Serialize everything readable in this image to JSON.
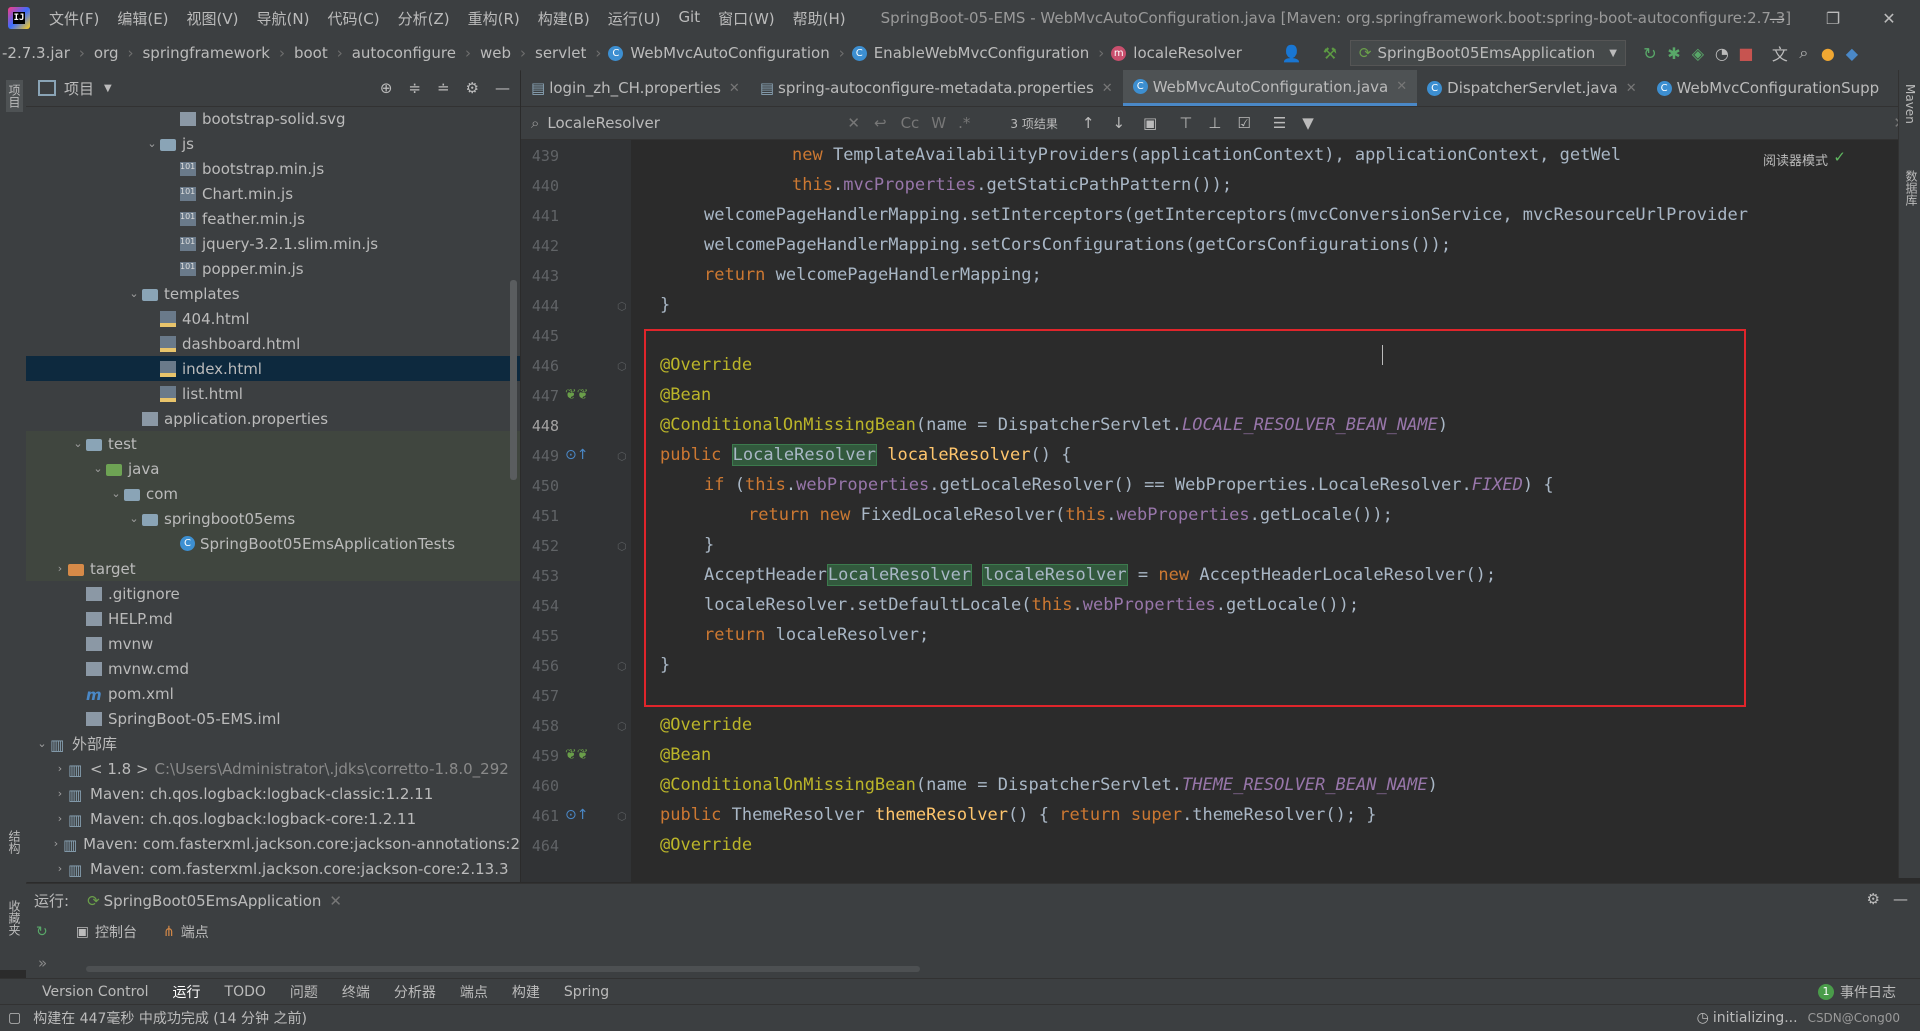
{
  "menu": [
    "文件(F)",
    "编辑(E)",
    "视图(V)",
    "导航(N)",
    "代码(C)",
    "分析(Z)",
    "重构(R)",
    "构建(B)",
    "运行(U)",
    "Git",
    "窗口(W)",
    "帮助(H)"
  ],
  "window_title": "SpringBoot-05-EMS - WebMvcAutoConfiguration.java [Maven: org.springframework.boot:spring-boot-autoconfigure:2.7.3]",
  "breadcrumbs": [
    "-2.7.3.jar",
    "org",
    "springframework",
    "boot",
    "autoconfigure",
    "web",
    "servlet",
    "WebMvcAutoConfiguration",
    "EnableWebMvcConfiguration",
    "localeResolver"
  ],
  "run_config": "SpringBoot05EmsApplication",
  "project_panel": {
    "title": "项目"
  },
  "tree": [
    {
      "label": "bootstrap-solid.svg",
      "icon": "file"
    },
    {
      "label": "js",
      "icon": "folder"
    },
    {
      "label": "bootstrap.min.js",
      "icon": "js"
    },
    {
      "label": "Chart.min.js",
      "icon": "js"
    },
    {
      "label": "feather.min.js",
      "icon": "js"
    },
    {
      "label": "jquery-3.2.1.slim.min.js",
      "icon": "js"
    },
    {
      "label": "popper.min.js",
      "icon": "js"
    },
    {
      "label": "templates",
      "icon": "folder"
    },
    {
      "label": "404.html",
      "icon": "html"
    },
    {
      "label": "dashboard.html",
      "icon": "html"
    },
    {
      "label": "index.html",
      "icon": "html"
    },
    {
      "label": "list.html",
      "icon": "html"
    },
    {
      "label": "application.properties",
      "icon": "file"
    },
    {
      "label": "test",
      "icon": "folder"
    },
    {
      "label": "java",
      "icon": "folder-green"
    },
    {
      "label": "com",
      "icon": "folder"
    },
    {
      "label": "springboot05ems",
      "icon": "folder"
    },
    {
      "label": "SpringBoot05EmsApplicationTests",
      "icon": "class"
    },
    {
      "label": "target",
      "icon": "folder-orange"
    },
    {
      "label": ".gitignore",
      "icon": "file"
    },
    {
      "label": "HELP.md",
      "icon": "file"
    },
    {
      "label": "mvnw",
      "icon": "file"
    },
    {
      "label": "mvnw.cmd",
      "icon": "file"
    },
    {
      "label": "pom.xml",
      "icon": "maven"
    },
    {
      "label": "SpringBoot-05-EMS.iml",
      "icon": "file"
    },
    {
      "label": "外部库",
      "icon": "lib"
    },
    {
      "label": "< 1.8 >",
      "icon": "lib",
      "extra": "C:\\Users\\Administrator\\.jdks\\corretto-1.8.0_292"
    },
    {
      "label": "Maven: ch.qos.logback:logback-classic:1.2.11",
      "icon": "lib"
    },
    {
      "label": "Maven: ch.qos.logback:logback-core:1.2.11",
      "icon": "lib"
    },
    {
      "label": "Maven: com.fasterxml.jackson.core:jackson-annotations:2",
      "icon": "lib"
    },
    {
      "label": "Maven: com.fasterxml.jackson.core:jackson-core:2.13.3",
      "icon": "lib"
    }
  ],
  "tabs": [
    "login_zh_CH.properties",
    "spring-autoconfigure-metadata.properties",
    "WebMvcAutoConfiguration.java",
    "DispatcherServlet.java",
    "WebMvcConfigurationSupp"
  ],
  "search": {
    "query": "LocaleResolver",
    "results": "3 项结果",
    "options": [
      "Cc",
      "W",
      ".*"
    ]
  },
  "reader_mode": "阅读器模式",
  "line_numbers": [
    "439",
    "440",
    "441",
    "442",
    "443",
    "444",
    "445",
    "446",
    "447",
    "448",
    "449",
    "450",
    "451",
    "452",
    "453",
    "454",
    "455",
    "456",
    "457",
    "458",
    "459",
    "460",
    "461",
    "464"
  ],
  "code_lines": [
    "new TemplateAvailabilityProviders(applicationContext), applicationContext, getWel",
    "this.mvcProperties.getStaticPathPattern());",
    "welcomePageHandlerMapping.setInterceptors(getInterceptors(mvcConversionService, mvcResourceUrlProvider",
    "welcomePageHandlerMapping.setCorsConfigurations(getCorsConfigurations());",
    "return welcomePageHandlerMapping;",
    "}",
    "",
    "@Override",
    "@Bean",
    "@ConditionalOnMissingBean(name = DispatcherServlet.LOCALE_RESOLVER_BEAN_NAME)",
    "public LocaleResolver localeResolver() {",
    "if (this.webProperties.getLocaleResolver() == WebProperties.LocaleResolver.FIXED) {",
    "return new FixedLocaleResolver(this.webProperties.getLocale());",
    "}",
    "AcceptHeaderLocaleResolver localeResolver = new AcceptHeaderLocaleResolver();",
    "localeResolver.setDefaultLocale(this.webProperties.getLocale());",
    "return localeResolver;",
    "}",
    "",
    "@Override",
    "@Bean",
    "@ConditionalOnMissingBean(name = DispatcherServlet.THEME_RESOLVER_BEAN_NAME)",
    "public ThemeResolver themeResolver() { return super.themeResolver(); }",
    "@Override"
  ],
  "run_panel": {
    "label": "运行:",
    "config": "SpringBoot05EmsApplication",
    "tabs": [
      "控制台",
      "端点"
    ]
  },
  "tool_windows": [
    "Version Control",
    "运行",
    "TODO",
    "问题",
    "终端",
    "分析器",
    "端点",
    "构建",
    "Spring"
  ],
  "event_log": {
    "count": "1",
    "label": "事件日志"
  },
  "status": {
    "message": "构建在 447毫秒 中成功完成 (14 分钟 之前)",
    "right": "initializing...",
    "watermark": "CSDN@Cong00"
  },
  "right_stripe": [
    "Maven",
    "数据库"
  ],
  "left_stripe": [
    "项目",
    "结构",
    "收藏夹"
  ]
}
